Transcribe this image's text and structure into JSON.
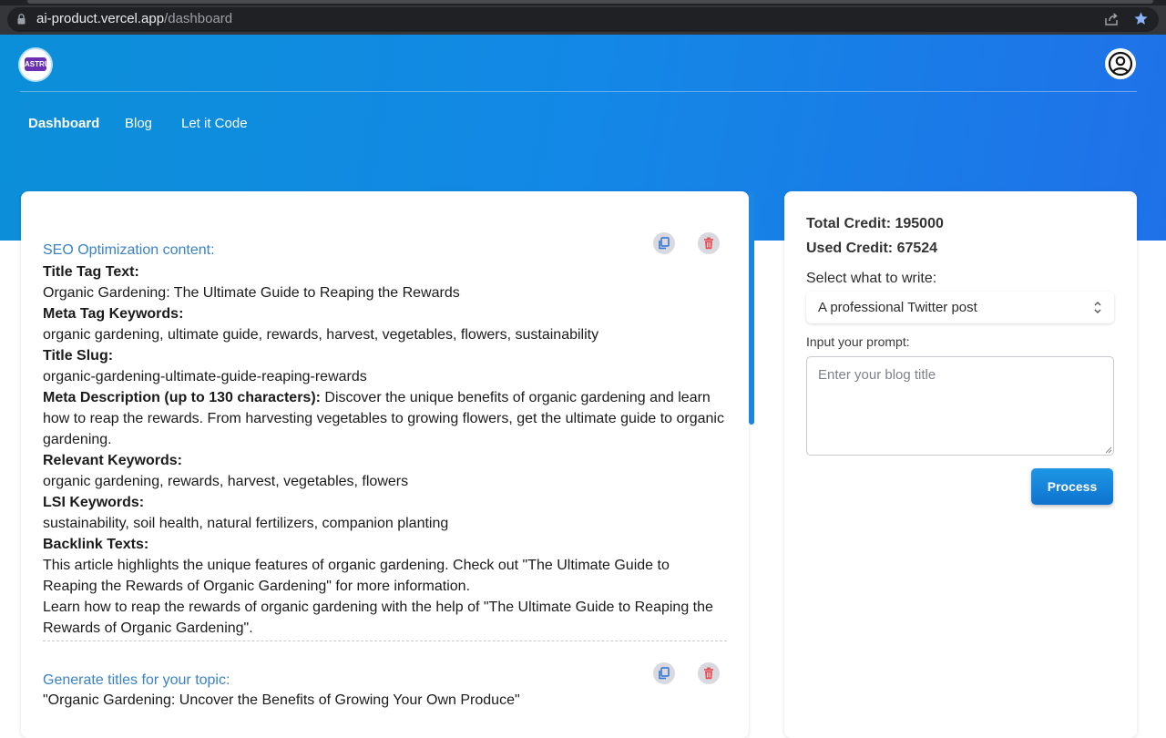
{
  "browser": {
    "url_host": "ai-product.vercel.app",
    "url_path": "/dashboard"
  },
  "header": {
    "logo_text": "ASTRU",
    "nav": [
      {
        "label": "Dashboard",
        "active": true
      },
      {
        "label": "Blog",
        "active": false
      },
      {
        "label": "Let it Code",
        "active": false
      }
    ]
  },
  "results": [
    {
      "heading": "SEO Optimization content:",
      "items": [
        {
          "label": "Title Tag Text:",
          "text": "Organic Gardening: The Ultimate Guide to Reaping the Rewards"
        },
        {
          "label": "Meta Tag Keywords:",
          "text": "organic gardening, ultimate guide, rewards, harvest, vegetables, flowers, sustainability"
        },
        {
          "label": "Title Slug:",
          "text": "organic-gardening-ultimate-guide-reaping-rewards"
        },
        {
          "label": "Meta Description (up to 130 characters):",
          "text": "Discover the unique benefits of organic gardening and learn how to reap the rewards. From harvesting vegetables to growing flowers, get the ultimate guide to organic gardening."
        },
        {
          "label": "Relevant Keywords:",
          "text": "organic gardening, rewards, harvest, vegetables, flowers"
        },
        {
          "label": "LSI Keywords:",
          "text": "sustainability, soil health, natural fertilizers, companion planting"
        },
        {
          "label": "Backlink Texts:",
          "text": "This article highlights the unique features of organic gardening. Check out \"The Ultimate Guide to Reaping the Rewards of Organic Gardening\" for more information."
        },
        {
          "label": "",
          "text": "Learn how to reap the rewards of organic gardening with the help of \"The Ultimate Guide to Reaping the Rewards of Organic Gardening\"."
        }
      ]
    },
    {
      "heading": "Generate titles for your topic:",
      "first_line": "\"Organic Gardening: Uncover the Benefits of Growing Your Own Produce\""
    }
  ],
  "sidebar": {
    "total_credit": "Total Credit: 195000",
    "used_credit": "Used Credit: 67524",
    "select_label": "Select what to write:",
    "select_value": "A professional Twitter post",
    "prompt_label": "Input your prompt:",
    "prompt_placeholder": "Enter your blog title",
    "process_label": "Process"
  },
  "colors": {
    "hero_start": "#0b8fd8",
    "hero_end": "#1f71e8",
    "heading_blue": "#3b82c4",
    "delete_red": "#e5484d"
  }
}
